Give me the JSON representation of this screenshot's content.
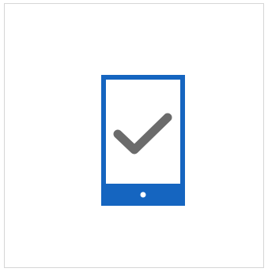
{
  "tile": {
    "icon": "phone-checkmark-icon",
    "colors": {
      "background": "#ffffff",
      "border": "#d6d6d6",
      "device": "#1565c0",
      "checkmark": "#6b6b6b",
      "home_dot": "#ffffff"
    }
  }
}
